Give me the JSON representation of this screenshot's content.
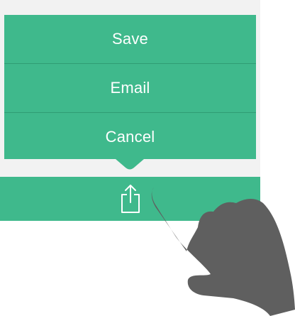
{
  "share_menu": {
    "items": [
      {
        "label": "Save"
      },
      {
        "label": "Email"
      },
      {
        "label": "Cancel"
      }
    ]
  },
  "share_bar": {
    "icon": "share-icon"
  },
  "overlay": {
    "icon": "pointing-hand-icon"
  },
  "colors": {
    "accent": "#3fb98c",
    "divider": "#2f9c74",
    "backdrop": "#f2f2f2",
    "hand": "#5f5f5f",
    "text": "#ffffff"
  }
}
